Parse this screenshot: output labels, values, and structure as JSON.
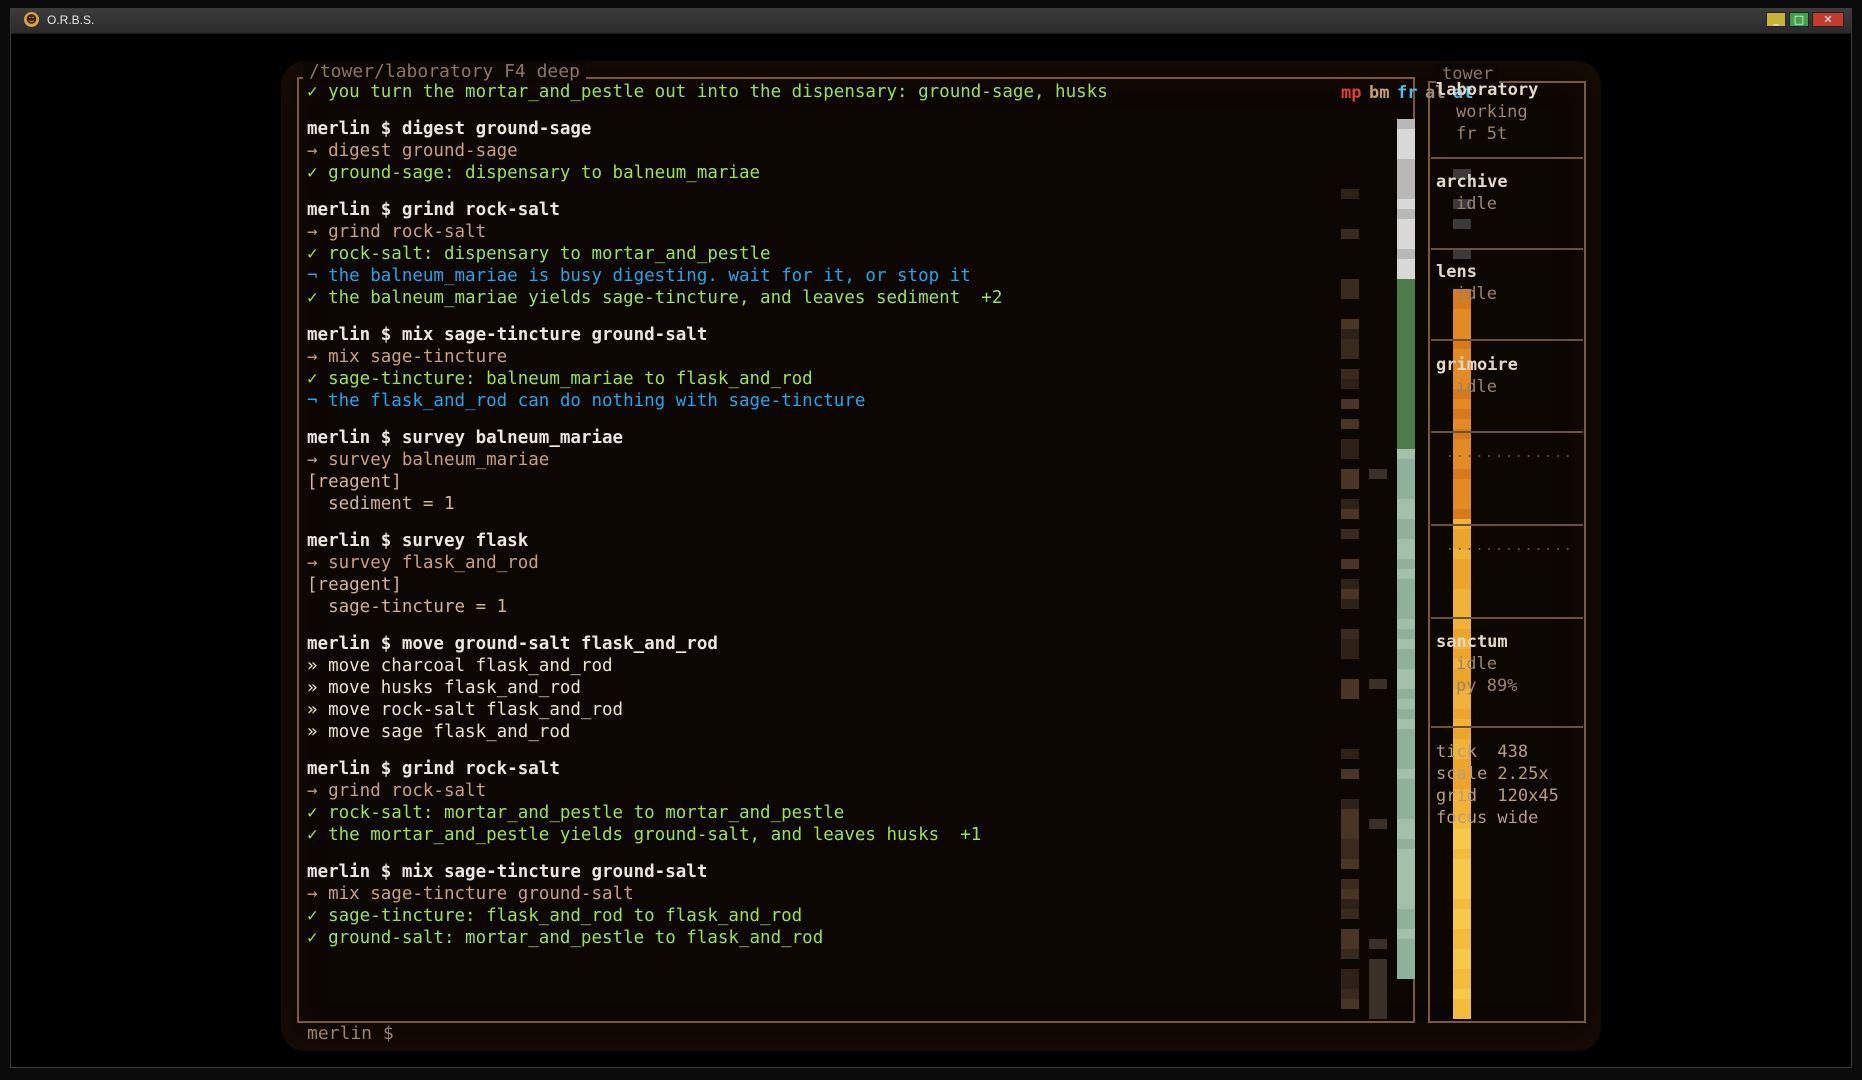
{
  "window": {
    "title": "O.R.B.S.",
    "icon": "app-icon",
    "buttons": [
      "minimize",
      "maximize",
      "close"
    ],
    "min_glyph": "_",
    "max_glyph": "□",
    "close_glyph": "✕"
  },
  "header": {
    "path": "/tower/laboratory  F4 deep"
  },
  "log": [
    {
      "type": "ok",
      "text": "✓ you turn the mortar_and_pestle out into the dispensary: ground-sage, husks"
    },
    {
      "type": "gap"
    },
    {
      "type": "cmd",
      "text": "merlin $ digest ground-sage"
    },
    {
      "type": "echo",
      "text": "→ digest ground-sage"
    },
    {
      "type": "ok",
      "text": "✓ ground-sage: dispensary to balneum_mariae"
    },
    {
      "type": "gap"
    },
    {
      "type": "cmd",
      "text": "merlin $ grind rock-salt"
    },
    {
      "type": "echo",
      "text": "→ grind rock-salt"
    },
    {
      "type": "ok",
      "text": "✓ rock-salt: dispensary to mortar_and_pestle"
    },
    {
      "type": "warn",
      "text": "¬ the balneum_mariae is busy digesting. wait for it, or stop it"
    },
    {
      "type": "ok",
      "text": "✓ the balneum_mariae yields sage-tincture, and leaves sediment  +2"
    },
    {
      "type": "gap"
    },
    {
      "type": "cmd",
      "text": "merlin $ mix sage-tincture ground-salt"
    },
    {
      "type": "echo",
      "text": "→ mix sage-tincture"
    },
    {
      "type": "ok",
      "text": "✓ sage-tincture: balneum_mariae to flask_and_rod"
    },
    {
      "type": "warn",
      "text": "¬ the flask_and_rod can do nothing with sage-tincture"
    },
    {
      "type": "gap"
    },
    {
      "type": "cmd",
      "text": "merlin $ survey balneum_mariae"
    },
    {
      "type": "echo",
      "text": "→ survey balneum_mariae"
    },
    {
      "type": "plain",
      "text": "[reagent]"
    },
    {
      "type": "plain",
      "text": "  sediment = 1"
    },
    {
      "type": "gap"
    },
    {
      "type": "cmd",
      "text": "merlin $ survey flask"
    },
    {
      "type": "echo",
      "text": "→ survey flask_and_rod"
    },
    {
      "type": "plain",
      "text": "[reagent]"
    },
    {
      "type": "plain",
      "text": "  sage-tincture = 1"
    },
    {
      "type": "gap"
    },
    {
      "type": "cmd",
      "text": "merlin $ move ground-salt flask_and_rod"
    },
    {
      "type": "move",
      "text": "» move charcoal flask_and_rod"
    },
    {
      "type": "move",
      "text": "» move husks flask_and_rod"
    },
    {
      "type": "move",
      "text": "» move rock-salt flask_and_rod"
    },
    {
      "type": "move",
      "text": "» move sage flask_and_rod"
    },
    {
      "type": "gap"
    },
    {
      "type": "cmd",
      "text": "merlin $ grind rock-salt"
    },
    {
      "type": "echo",
      "text": "→ grind rock-salt"
    },
    {
      "type": "ok",
      "text": "✓ rock-salt: mortar_and_pestle to mortar_and_pestle"
    },
    {
      "type": "ok",
      "text": "✓ the mortar_and_pestle yields ground-salt, and leaves husks  +1"
    },
    {
      "type": "gap"
    },
    {
      "type": "cmd",
      "text": "merlin $ mix sage-tincture ground-salt"
    },
    {
      "type": "echo",
      "text": "→ mix sage-tincture ground-salt"
    },
    {
      "type": "ok",
      "text": "✓ sage-tincture: flask_and_rod to flask_and_rod"
    },
    {
      "type": "ok",
      "text": "✓ ground-salt: mortar_and_pestle to flask_and_rod"
    }
  ],
  "meters": {
    "labels": [
      {
        "text": "mp",
        "color": "#e0402c"
      },
      {
        "text": "bm",
        "color": "#c8a06a"
      },
      {
        "text": "fr",
        "color": "#4fb8f0"
      },
      {
        "text": "al",
        "color": "#9a8b78"
      },
      {
        "text": "at",
        "color": "#4fb8f0"
      }
    ]
  },
  "sidebar": {
    "header": "tower",
    "sections": [
      {
        "title": "laboratory",
        "lines": [
          "working",
          "fr 5t"
        ]
      },
      {
        "title": "archive",
        "lines": [
          "idle"
        ]
      },
      {
        "title": "lens",
        "lines": [
          "idle"
        ]
      },
      {
        "title": "grimoire",
        "lines": [
          "idle"
        ]
      },
      {
        "title": "sanctum",
        "lines": [
          "idle",
          "py 89%"
        ]
      }
    ],
    "stats": [
      "tick  438",
      "scale 2.25x",
      "grid  120x45",
      "focus wide"
    ]
  },
  "prompt": "merlin $"
}
